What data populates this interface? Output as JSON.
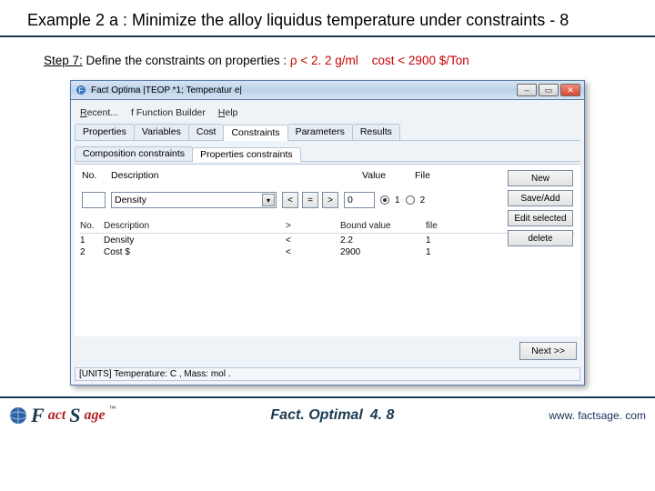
{
  "title": "Example 2 a : Minimize the alloy liquidus temperature under constraints - 8",
  "step": {
    "label": "Step 7:",
    "text": " Define the constraints on properties :  ",
    "c1": "ρ < 2. 2 g/ml",
    "c2": "cost < 2900 $/Ton"
  },
  "win": {
    "title": "Fact Optima    |TEOP *1; Temperatur e|",
    "menus": {
      "recent": "Recent...",
      "fb": "f  Function Builder",
      "help": "Help"
    },
    "tabs": {
      "props": "Properties",
      "vars": "Variables",
      "cost": "Cost",
      "cons": "Constraints",
      "params": "Parameters",
      "res": "Results"
    },
    "subtabs": {
      "comp": "Composition constraints",
      "propc": "Properties constraints"
    },
    "form": {
      "no_label": "No.",
      "desc_label": "Description",
      "val_label": "Value",
      "file_label": "File",
      "desc_value": "Density",
      "val_value": "0",
      "lt": "<",
      "eq": "=",
      "gt": ">",
      "file_opt1": "1",
      "file_opt2": "2"
    },
    "actions": {
      "new": "New",
      "save": "Save/Add",
      "edit": "Edit selected",
      "del": "delete"
    },
    "list": {
      "h_no": "No.",
      "h_desc": "Description",
      "h_lt": ">",
      "h_bound": "Bound value",
      "h_file": "file",
      "rows": [
        {
          "no": "1",
          "desc": "Density",
          "op": "<",
          "bound": "2.2",
          "file": "1"
        },
        {
          "no": "2",
          "desc": "Cost $",
          "op": "<",
          "bound": "2900",
          "file": "1"
        }
      ]
    },
    "next": "Next >>",
    "status": {
      "units": "[UNITS] Temperature: C , Mass: mol ."
    }
  },
  "footer": {
    "product": "Fact. Optimal",
    "ver": "4. 8",
    "url": "www. factsage. com"
  }
}
